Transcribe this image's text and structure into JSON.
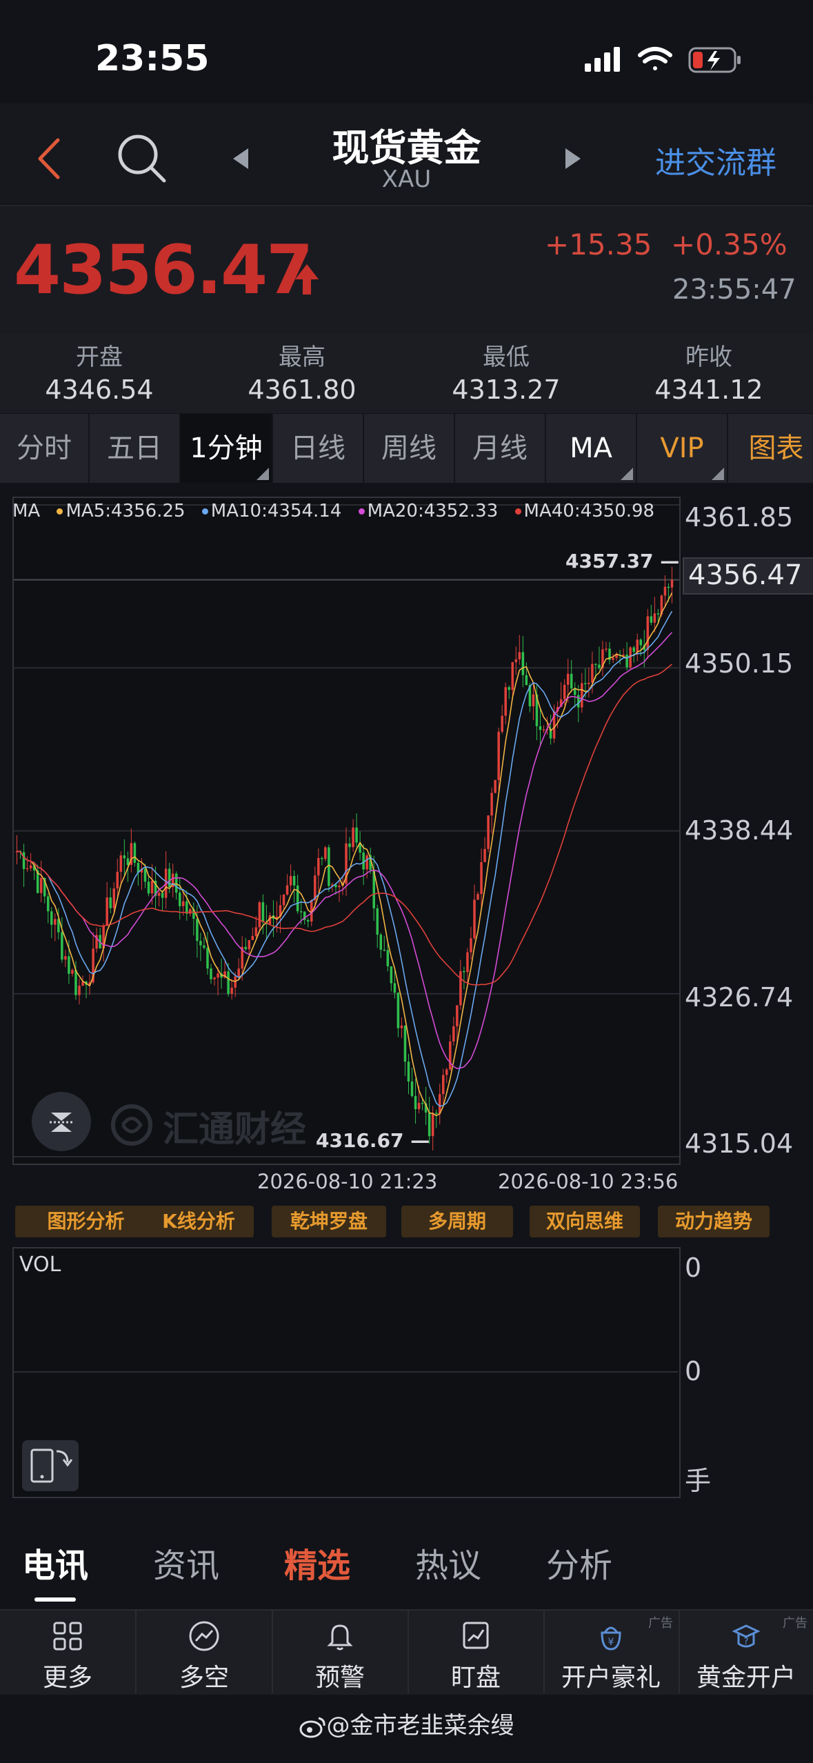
{
  "status_bar": {
    "time": "23:55"
  },
  "header": {
    "title": "现货黄金",
    "subtitle": "XAU",
    "join_group": "进交流群"
  },
  "quote": {
    "price": "4356.47",
    "change": "+15.35",
    "change_pct": "+0.35%",
    "time": "23:55:47",
    "up_color": "#c8302c"
  },
  "stats": [
    {
      "label": "开盘",
      "value": "4346.54"
    },
    {
      "label": "最高",
      "value": "4361.80"
    },
    {
      "label": "最低",
      "value": "4313.27"
    },
    {
      "label": "昨收",
      "value": "4341.12"
    }
  ],
  "period_tabs": [
    {
      "label": "分时"
    },
    {
      "label": "五日"
    },
    {
      "label": "1分钟",
      "active": true
    },
    {
      "label": "日线"
    },
    {
      "label": "周线"
    },
    {
      "label": "月线"
    },
    {
      "label": "MA"
    },
    {
      "label": "VIP"
    },
    {
      "label": "图表"
    }
  ],
  "chart_data": {
    "type": "candlestick",
    "ma_label": "MA",
    "ma_legend": [
      {
        "name": "MA5",
        "text": "MA5:4356.25",
        "color": "#f2b544"
      },
      {
        "name": "MA10",
        "text": "MA10:4354.14",
        "color": "#6aa8ef"
      },
      {
        "name": "MA20",
        "text": "MA20:4352.33",
        "color": "#d44cd6"
      },
      {
        "name": "MA40",
        "text": "MA40:4350.98",
        "color": "#e0413a"
      }
    ],
    "y_ticks": [
      "4361.85",
      "4350.15",
      "4338.44",
      "4326.74",
      "4315.04"
    ],
    "current_price": "4356.47",
    "high_label": "4357.37",
    "low_label": "4316.67",
    "x_ticks": [
      "2026-08-10 21:23",
      "2026-08-10 23:56"
    ],
    "ylim": [
      4315.04,
      4361.85
    ],
    "close_path": [
      4337,
      4336,
      4333,
      4330,
      4327,
      4329,
      4333,
      4337,
      4336,
      4334,
      4335,
      4333,
      4331,
      4328,
      4327,
      4330,
      4333,
      4331,
      4335,
      4332,
      4337,
      4334,
      4338,
      4336,
      4330,
      4325,
      4320,
      4317,
      4321,
      4327,
      4333,
      4340,
      4348,
      4351,
      4347,
      4346,
      4349,
      4348,
      4350,
      4351,
      4350,
      4352,
      4354,
      4356.47
    ],
    "watermark": "汇通财经"
  },
  "tools": [
    "图形分析",
    "K线分析",
    "乾坤罗盘",
    "多周期",
    "双向思维",
    "动力趋势"
  ],
  "volume": {
    "label": "VOL",
    "ticks": [
      "0",
      "0",
      "手"
    ]
  },
  "news_tabs": [
    "电讯",
    "资讯",
    "精选",
    "热议",
    "分析"
  ],
  "bottom_bar": [
    {
      "label": "更多",
      "icon": "grid-icon"
    },
    {
      "label": "多空",
      "icon": "trend-icon"
    },
    {
      "label": "预警",
      "icon": "bell-icon"
    },
    {
      "label": "盯盘",
      "icon": "monitor-icon"
    },
    {
      "label": "开户豪礼",
      "icon": "gift-icon",
      "ad": "广告"
    },
    {
      "label": "黄金开户",
      "icon": "gold-icon",
      "ad": "广告"
    }
  ],
  "credit": "@金市老韭菜余缦"
}
